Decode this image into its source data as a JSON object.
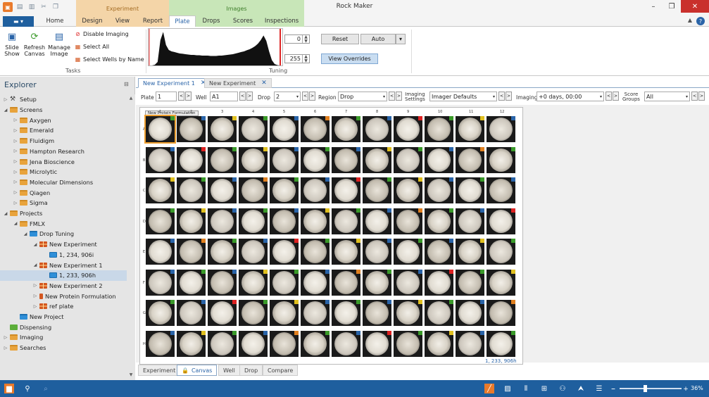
{
  "window": {
    "title": "Rock Maker"
  },
  "context_tabs": {
    "experiment": "Experiment",
    "images": "Images"
  },
  "tabs": [
    "Home",
    "Design",
    "View",
    "Report",
    "Plate",
    "Drops",
    "Scores",
    "Inspections"
  ],
  "selected_tab": "Plate",
  "ribbon": {
    "slide_show": "Slide\nShow",
    "refresh_canvas": "Refresh\nCanvas",
    "manage_image": "Manage\nImage",
    "disable_imaging": "Disable Imaging",
    "select_all": "Select All",
    "select_wells_by_name": "Select Wells by Name",
    "tasks_label": "Tasks",
    "tuning_label": "Tuning",
    "tuning_low": "0",
    "tuning_high": "255",
    "reset": "Reset",
    "auto": "Auto",
    "view_overrides": "View Overrides",
    "histogram": [
      0,
      0,
      2,
      10,
      72,
      95,
      58,
      44,
      40,
      38,
      36,
      34,
      33,
      32,
      31,
      30,
      30,
      29,
      29,
      28,
      28,
      28,
      27,
      27,
      27,
      28,
      28,
      29,
      30,
      31,
      32,
      34,
      36,
      38,
      40,
      43,
      46,
      50,
      55,
      62,
      72,
      85,
      70,
      40,
      15,
      4,
      1,
      0
    ]
  },
  "explorer": {
    "title": "Explorer",
    "tree": [
      {
        "label": "Setup",
        "depth": 0,
        "icon": "gear",
        "arrow": "right"
      },
      {
        "label": "Screens",
        "depth": 0,
        "icon": "folder",
        "arrow": "down"
      },
      {
        "label": "Axygen",
        "depth": 1,
        "icon": "folder",
        "arrow": "right"
      },
      {
        "label": "Emerald",
        "depth": 1,
        "icon": "folder",
        "arrow": "right"
      },
      {
        "label": "Fluidigm",
        "depth": 1,
        "icon": "folder",
        "arrow": "right"
      },
      {
        "label": "Hampton Research",
        "depth": 1,
        "icon": "folder",
        "arrow": "right"
      },
      {
        "label": "Jena Bioscience",
        "depth": 1,
        "icon": "folder",
        "arrow": "right"
      },
      {
        "label": "Microlytic",
        "depth": 1,
        "icon": "folder",
        "arrow": "right"
      },
      {
        "label": "Molecular Dimensions",
        "depth": 1,
        "icon": "folder",
        "arrow": "right"
      },
      {
        "label": "Qiagen",
        "depth": 1,
        "icon": "folder",
        "arrow": "right"
      },
      {
        "label": "Sigma",
        "depth": 1,
        "icon": "folder",
        "arrow": "right"
      },
      {
        "label": "Projects",
        "depth": 0,
        "icon": "folder",
        "arrow": "down"
      },
      {
        "label": "FMLX",
        "depth": 1,
        "icon": "folder",
        "arrow": "down"
      },
      {
        "label": "Drop Tuning",
        "depth": 2,
        "icon": "bfolder",
        "arrow": "down"
      },
      {
        "label": "New Experiment",
        "depth": 3,
        "icon": "grid",
        "arrow": "down"
      },
      {
        "label": "1, 234, 906i",
        "depth": 4,
        "icon": "img",
        "arrow": ""
      },
      {
        "label": "New Experiment 1",
        "depth": 3,
        "icon": "grid",
        "arrow": "down"
      },
      {
        "label": "1, 233, 906h",
        "depth": 4,
        "icon": "img",
        "arrow": "",
        "selected": true
      },
      {
        "label": "New Experiment 2",
        "depth": 3,
        "icon": "grid",
        "arrow": "right"
      },
      {
        "label": "New Protein Formulation",
        "depth": 3,
        "icon": "bottle",
        "arrow": "right"
      },
      {
        "label": "ref plate",
        "depth": 3,
        "icon": "grid",
        "arrow": "right"
      },
      {
        "label": "New Project",
        "depth": 1,
        "icon": "bfolder",
        "arrow": ""
      },
      {
        "label": "Dispensing",
        "depth": 0,
        "icon": "ggrid",
        "arrow": ""
      },
      {
        "label": "Imaging",
        "depth": 0,
        "icon": "folder",
        "arrow": "right"
      },
      {
        "label": "Searches",
        "depth": 0,
        "icon": "folder",
        "arrow": "right"
      }
    ]
  },
  "doc_tabs": [
    {
      "label": "New Experiment 1",
      "active": true,
      "close": "✕"
    },
    {
      "label": "New Experiment",
      "active": false,
      "close": "✕"
    }
  ],
  "filters": {
    "plate_label": "Plate",
    "plate_value": "1",
    "well_label": "Well",
    "well_value": "A1",
    "drop_label": "Drop",
    "drop_value": "2",
    "region_label": "Region",
    "region_value": "Drop",
    "imaging_settings_label": "Imaging\nSettings",
    "imaging_settings_value": "Imager Defaults",
    "imaging_label": "Imaging",
    "imaging_value": "+0 days, 00:00",
    "score_groups_label": "Score\nGroups",
    "score_groups_value": "All"
  },
  "plate": {
    "columns": [
      "1",
      "2",
      "3",
      "4",
      "5",
      "6",
      "7",
      "8",
      "9",
      "10",
      "11",
      "12"
    ],
    "rows": [
      "A",
      "B",
      "C",
      "D",
      "E",
      "F",
      "G",
      "H"
    ],
    "name_tag": "New Protein Formulation",
    "barcode": "1, 233, 906h"
  },
  "view_tabs": [
    "Experiment",
    "Canvas",
    "Well",
    "Drop",
    "Compare"
  ],
  "active_view": "Canvas",
  "status": {
    "zoom": "36%"
  }
}
